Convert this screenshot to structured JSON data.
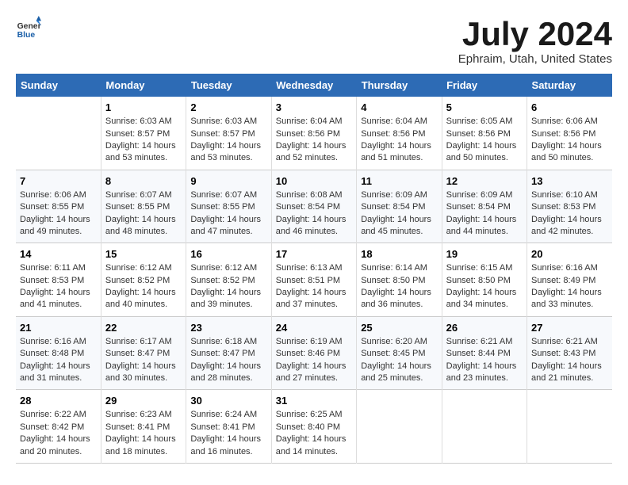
{
  "logo": {
    "text_general": "General",
    "text_blue": "Blue"
  },
  "header": {
    "month_year": "July 2024",
    "location": "Ephraim, Utah, United States"
  },
  "weekdays": [
    "Sunday",
    "Monday",
    "Tuesday",
    "Wednesday",
    "Thursday",
    "Friday",
    "Saturday"
  ],
  "weeks": [
    [
      {
        "day": "",
        "sunrise": "",
        "sunset": "",
        "daylight": ""
      },
      {
        "day": "1",
        "sunrise": "Sunrise: 6:03 AM",
        "sunset": "Sunset: 8:57 PM",
        "daylight": "Daylight: 14 hours and 53 minutes."
      },
      {
        "day": "2",
        "sunrise": "Sunrise: 6:03 AM",
        "sunset": "Sunset: 8:57 PM",
        "daylight": "Daylight: 14 hours and 53 minutes."
      },
      {
        "day": "3",
        "sunrise": "Sunrise: 6:04 AM",
        "sunset": "Sunset: 8:56 PM",
        "daylight": "Daylight: 14 hours and 52 minutes."
      },
      {
        "day": "4",
        "sunrise": "Sunrise: 6:04 AM",
        "sunset": "Sunset: 8:56 PM",
        "daylight": "Daylight: 14 hours and 51 minutes."
      },
      {
        "day": "5",
        "sunrise": "Sunrise: 6:05 AM",
        "sunset": "Sunset: 8:56 PM",
        "daylight": "Daylight: 14 hours and 50 minutes."
      },
      {
        "day": "6",
        "sunrise": "Sunrise: 6:06 AM",
        "sunset": "Sunset: 8:56 PM",
        "daylight": "Daylight: 14 hours and 50 minutes."
      }
    ],
    [
      {
        "day": "7",
        "sunrise": "Sunrise: 6:06 AM",
        "sunset": "Sunset: 8:55 PM",
        "daylight": "Daylight: 14 hours and 49 minutes."
      },
      {
        "day": "8",
        "sunrise": "Sunrise: 6:07 AM",
        "sunset": "Sunset: 8:55 PM",
        "daylight": "Daylight: 14 hours and 48 minutes."
      },
      {
        "day": "9",
        "sunrise": "Sunrise: 6:07 AM",
        "sunset": "Sunset: 8:55 PM",
        "daylight": "Daylight: 14 hours and 47 minutes."
      },
      {
        "day": "10",
        "sunrise": "Sunrise: 6:08 AM",
        "sunset": "Sunset: 8:54 PM",
        "daylight": "Daylight: 14 hours and 46 minutes."
      },
      {
        "day": "11",
        "sunrise": "Sunrise: 6:09 AM",
        "sunset": "Sunset: 8:54 PM",
        "daylight": "Daylight: 14 hours and 45 minutes."
      },
      {
        "day": "12",
        "sunrise": "Sunrise: 6:09 AM",
        "sunset": "Sunset: 8:54 PM",
        "daylight": "Daylight: 14 hours and 44 minutes."
      },
      {
        "day": "13",
        "sunrise": "Sunrise: 6:10 AM",
        "sunset": "Sunset: 8:53 PM",
        "daylight": "Daylight: 14 hours and 42 minutes."
      }
    ],
    [
      {
        "day": "14",
        "sunrise": "Sunrise: 6:11 AM",
        "sunset": "Sunset: 8:53 PM",
        "daylight": "Daylight: 14 hours and 41 minutes."
      },
      {
        "day": "15",
        "sunrise": "Sunrise: 6:12 AM",
        "sunset": "Sunset: 8:52 PM",
        "daylight": "Daylight: 14 hours and 40 minutes."
      },
      {
        "day": "16",
        "sunrise": "Sunrise: 6:12 AM",
        "sunset": "Sunset: 8:52 PM",
        "daylight": "Daylight: 14 hours and 39 minutes."
      },
      {
        "day": "17",
        "sunrise": "Sunrise: 6:13 AM",
        "sunset": "Sunset: 8:51 PM",
        "daylight": "Daylight: 14 hours and 37 minutes."
      },
      {
        "day": "18",
        "sunrise": "Sunrise: 6:14 AM",
        "sunset": "Sunset: 8:50 PM",
        "daylight": "Daylight: 14 hours and 36 minutes."
      },
      {
        "day": "19",
        "sunrise": "Sunrise: 6:15 AM",
        "sunset": "Sunset: 8:50 PM",
        "daylight": "Daylight: 14 hours and 34 minutes."
      },
      {
        "day": "20",
        "sunrise": "Sunrise: 6:16 AM",
        "sunset": "Sunset: 8:49 PM",
        "daylight": "Daylight: 14 hours and 33 minutes."
      }
    ],
    [
      {
        "day": "21",
        "sunrise": "Sunrise: 6:16 AM",
        "sunset": "Sunset: 8:48 PM",
        "daylight": "Daylight: 14 hours and 31 minutes."
      },
      {
        "day": "22",
        "sunrise": "Sunrise: 6:17 AM",
        "sunset": "Sunset: 8:47 PM",
        "daylight": "Daylight: 14 hours and 30 minutes."
      },
      {
        "day": "23",
        "sunrise": "Sunrise: 6:18 AM",
        "sunset": "Sunset: 8:47 PM",
        "daylight": "Daylight: 14 hours and 28 minutes."
      },
      {
        "day": "24",
        "sunrise": "Sunrise: 6:19 AM",
        "sunset": "Sunset: 8:46 PM",
        "daylight": "Daylight: 14 hours and 27 minutes."
      },
      {
        "day": "25",
        "sunrise": "Sunrise: 6:20 AM",
        "sunset": "Sunset: 8:45 PM",
        "daylight": "Daylight: 14 hours and 25 minutes."
      },
      {
        "day": "26",
        "sunrise": "Sunrise: 6:21 AM",
        "sunset": "Sunset: 8:44 PM",
        "daylight": "Daylight: 14 hours and 23 minutes."
      },
      {
        "day": "27",
        "sunrise": "Sunrise: 6:21 AM",
        "sunset": "Sunset: 8:43 PM",
        "daylight": "Daylight: 14 hours and 21 minutes."
      }
    ],
    [
      {
        "day": "28",
        "sunrise": "Sunrise: 6:22 AM",
        "sunset": "Sunset: 8:42 PM",
        "daylight": "Daylight: 14 hours and 20 minutes."
      },
      {
        "day": "29",
        "sunrise": "Sunrise: 6:23 AM",
        "sunset": "Sunset: 8:41 PM",
        "daylight": "Daylight: 14 hours and 18 minutes."
      },
      {
        "day": "30",
        "sunrise": "Sunrise: 6:24 AM",
        "sunset": "Sunset: 8:41 PM",
        "daylight": "Daylight: 14 hours and 16 minutes."
      },
      {
        "day": "31",
        "sunrise": "Sunrise: 6:25 AM",
        "sunset": "Sunset: 8:40 PM",
        "daylight": "Daylight: 14 hours and 14 minutes."
      },
      {
        "day": "",
        "sunrise": "",
        "sunset": "",
        "daylight": ""
      },
      {
        "day": "",
        "sunrise": "",
        "sunset": "",
        "daylight": ""
      },
      {
        "day": "",
        "sunrise": "",
        "sunset": "",
        "daylight": ""
      }
    ]
  ]
}
